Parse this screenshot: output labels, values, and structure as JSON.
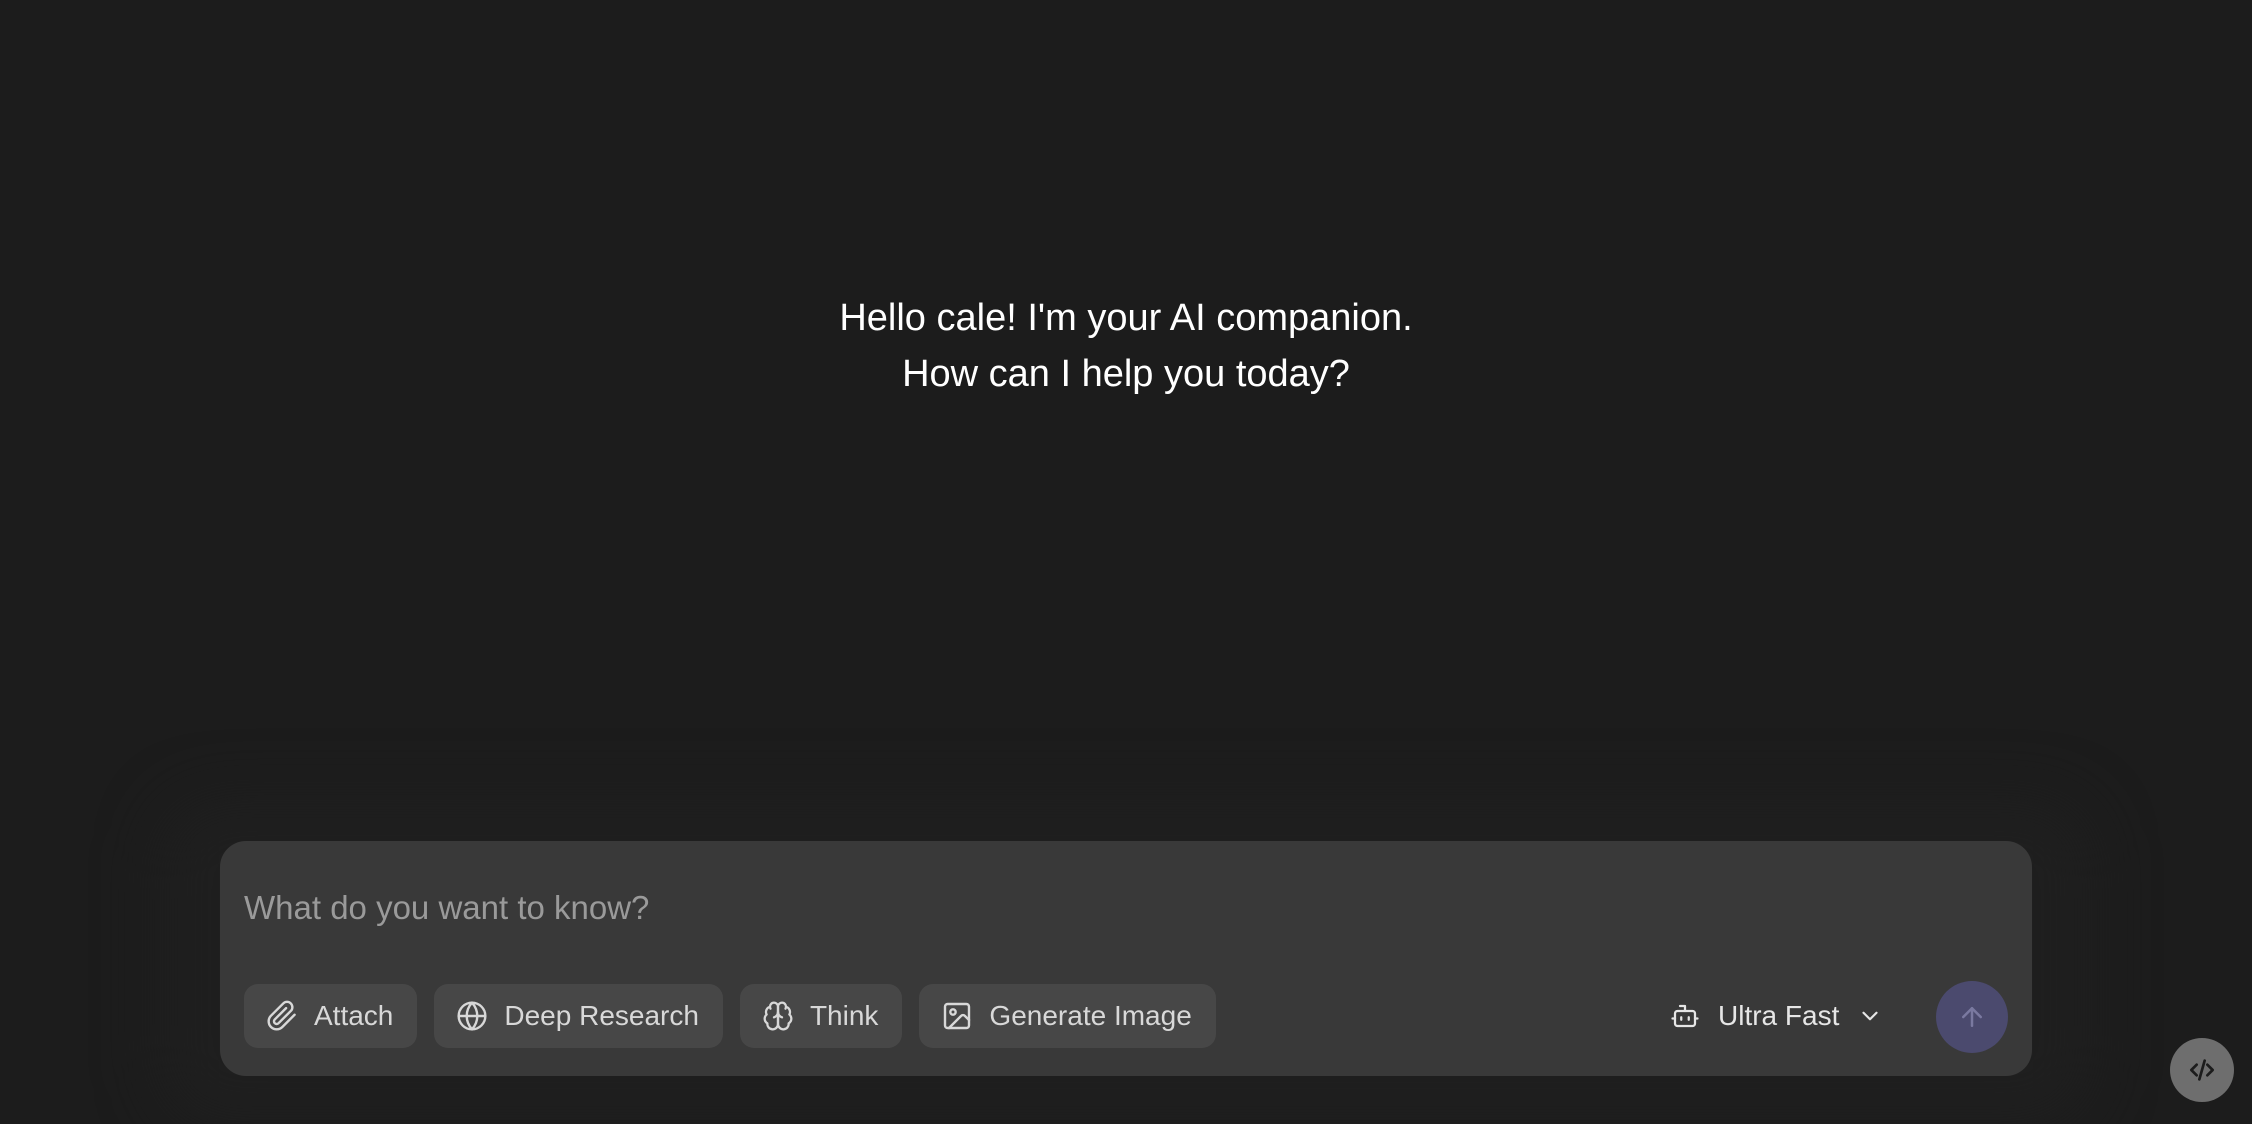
{
  "greeting": {
    "line1": "Hello cale! I'm your AI companion.",
    "line2": "How can I help you today?"
  },
  "composer": {
    "placeholder": "What do you want to know?",
    "value": "",
    "tools": {
      "attach": {
        "label": "Attach",
        "icon": "paperclip-icon"
      },
      "deep_research": {
        "label": "Deep Research",
        "icon": "globe-icon"
      },
      "think": {
        "label": "Think",
        "icon": "brain-icon"
      },
      "generate_image": {
        "label": "Generate Image",
        "icon": "image-icon"
      }
    },
    "model": {
      "label": "Ultra Fast",
      "icon": "robot-icon"
    },
    "send": {
      "icon": "arrow-up-icon"
    }
  },
  "dev_tools": {
    "icon": "code-icon"
  },
  "colors": {
    "background": "#1c1c1c",
    "composer": "#393939",
    "tool_button": "#474747",
    "send_button": "#4b4a6e",
    "text": "#ffffff",
    "placeholder": "#9a9a9a"
  }
}
